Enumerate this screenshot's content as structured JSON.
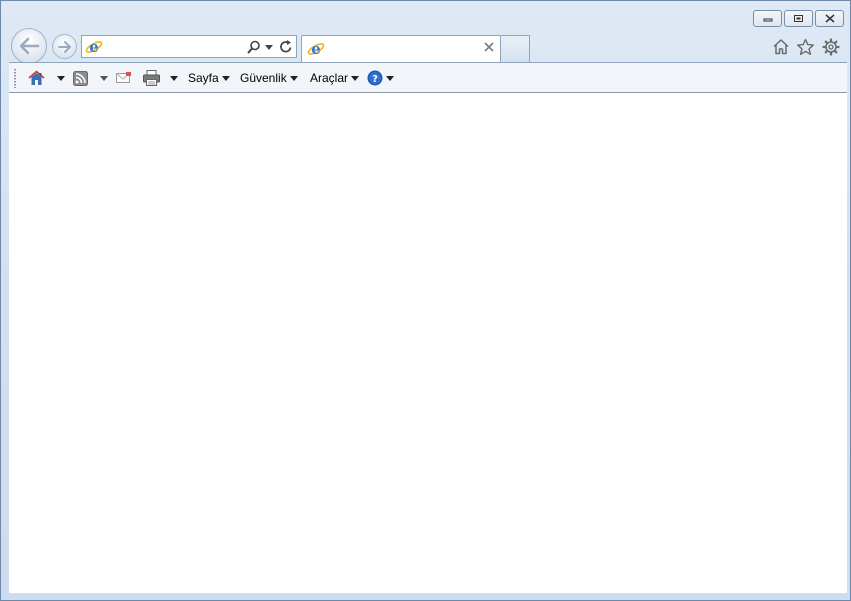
{
  "window": {
    "caption_buttons": [
      {
        "name": "minimize",
        "icon": "minimize-icon"
      },
      {
        "name": "restore",
        "icon": "restore-icon"
      },
      {
        "name": "close",
        "icon": "close-icon"
      }
    ]
  },
  "address_bar": {
    "value": "",
    "placeholder": "",
    "icons": [
      "ie-logo-icon",
      "search-icon",
      "chevron-down-icon",
      "refresh-icon"
    ]
  },
  "tab": {
    "title": "",
    "icon": "ie-logo-icon",
    "close_icon": "close-icon"
  },
  "right_icons": [
    "home-icon",
    "favorites-star-icon",
    "settings-gear-icon"
  ],
  "command_bar": {
    "page_label": "Sayfa",
    "security_label": "Güvenlik",
    "tools_label": "Araçlar",
    "icons": [
      "home-icon",
      "rss-feed-icon",
      "read-mail-icon",
      "print-icon",
      "help-icon"
    ]
  },
  "colors": {
    "frame": "#d3e1f1",
    "accent_blue": "#2d5fb3",
    "help_blue": "#1e57b8"
  }
}
